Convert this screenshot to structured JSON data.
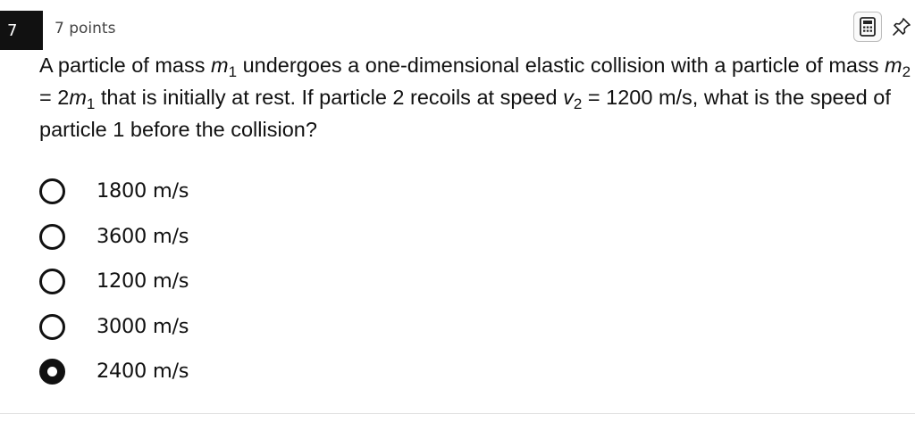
{
  "question": {
    "number": "7",
    "points": "7 points",
    "text": {
      "t1": "A particle of mass ",
      "m1_var": "m",
      "m1_sub": "1",
      "t2": " undergoes a one-dimensional elastic collision with a particle of mass ",
      "m2_var": "m",
      "m2_sub": "2",
      "t3": " = 2",
      "m1b_var": "m",
      "m1b_sub": "1",
      "t4": " that is initially at rest.  If particle 2 recoils at speed ",
      "v2_var": "v",
      "v2_sub": "2",
      "t5": " = 1200 m/s, what is the speed of particle 1 before the collision?"
    }
  },
  "toolbar": {
    "calculator_icon": "calculator-icon",
    "pin_icon": "pin-icon"
  },
  "options": [
    {
      "label": "1800 m/s",
      "selected": false
    },
    {
      "label": "3600 m/s",
      "selected": false
    },
    {
      "label": "1200 m/s",
      "selected": false
    },
    {
      "label": "3000 m/s",
      "selected": false
    },
    {
      "label": "2400 m/s",
      "selected": true
    }
  ]
}
